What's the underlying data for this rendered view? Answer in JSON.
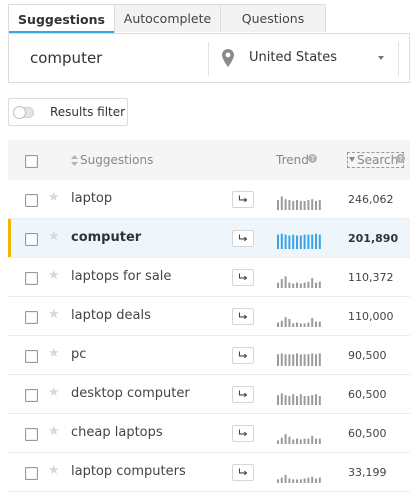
{
  "tabs": [
    {
      "label": "Suggestions",
      "active": true
    },
    {
      "label": "Autocomplete",
      "active": false
    },
    {
      "label": "Questions",
      "active": false
    }
  ],
  "search": {
    "query": "computer",
    "location": "United States"
  },
  "filter": {
    "label": "Results filter"
  },
  "table": {
    "headers": {
      "suggestions": "Suggestions",
      "trend": "Trend",
      "search": "Search"
    },
    "rows": [
      {
        "keyword": "laptop",
        "volume": "246,062",
        "trend": [
          0.55,
          0.75,
          0.6,
          0.55,
          0.5,
          0.55,
          0.5,
          0.5,
          0.55,
          0.6,
          0.5,
          0.55
        ],
        "selected": false
      },
      {
        "keyword": "computer",
        "volume": "201,890",
        "trend": [
          0.8,
          0.85,
          0.8,
          0.75,
          0.8,
          0.75,
          0.75,
          0.8,
          0.8,
          0.8,
          0.85,
          0.8
        ],
        "selected": true
      },
      {
        "keyword": "laptops for sale",
        "volume": "110,372",
        "trend": [
          0.3,
          0.5,
          0.65,
          0.3,
          0.25,
          0.3,
          0.25,
          0.3,
          0.35,
          0.55,
          0.3,
          0.35
        ],
        "selected": false
      },
      {
        "keyword": "laptop deals",
        "volume": "110,000",
        "trend": [
          0.25,
          0.35,
          0.55,
          0.45,
          0.2,
          0.25,
          0.2,
          0.2,
          0.25,
          0.5,
          0.3,
          0.3
        ],
        "selected": false
      },
      {
        "keyword": "pc",
        "volume": "90,500",
        "trend": [
          0.65,
          0.7,
          0.65,
          0.65,
          0.65,
          0.7,
          0.65,
          0.65,
          0.65,
          0.7,
          0.65,
          0.7
        ],
        "selected": false
      },
      {
        "keyword": "desktop computer",
        "volume": "60,500",
        "trend": [
          0.55,
          0.65,
          0.55,
          0.5,
          0.6,
          0.5,
          0.6,
          0.5,
          0.5,
          0.55,
          0.6,
          0.5
        ],
        "selected": false
      },
      {
        "keyword": "cheap laptops",
        "volume": "60,500",
        "trend": [
          0.2,
          0.35,
          0.55,
          0.4,
          0.25,
          0.3,
          0.25,
          0.3,
          0.3,
          0.45,
          0.3,
          0.3
        ],
        "selected": false
      },
      {
        "keyword": "laptop computers",
        "volume": "33,199",
        "trend": [
          0.2,
          0.3,
          0.45,
          0.25,
          0.2,
          0.2,
          0.2,
          0.25,
          0.3,
          0.35,
          0.25,
          0.3
        ],
        "selected": false
      }
    ]
  },
  "colors": {
    "accent": "#3aa3e3",
    "selected_bar": "#f2b600",
    "trend_bar": "#9b9b9b",
    "trend_bar_selected": "#3aa3e3"
  },
  "icons": {
    "location": "location-pin-icon",
    "sort": "sort-icon",
    "help": "help-icon",
    "star": "star-icon",
    "use": "use-keyword-icon"
  }
}
